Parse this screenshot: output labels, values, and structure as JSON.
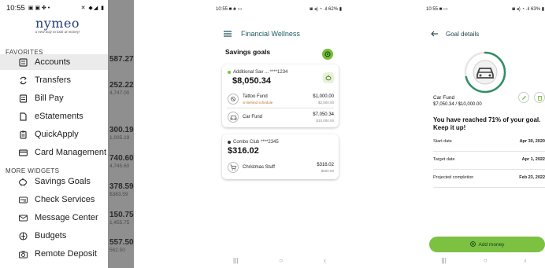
{
  "screen1": {
    "status": {
      "time": "10:55",
      "icons": "▣ ▣ ✤ •",
      "right": "✕ ◆◢ ▮"
    },
    "logo": {
      "word": "nymeo",
      "tagline": "a new way to look at money!"
    },
    "favorites_label": "FAVORITES",
    "favorites": [
      {
        "label": "Accounts",
        "icon": "accounts-icon",
        "active": true
      },
      {
        "label": "Transfers",
        "icon": "transfers-icon",
        "active": false
      },
      {
        "label": "Bill Pay",
        "icon": "bill-pay-icon",
        "active": false
      },
      {
        "label": "eStatements",
        "icon": "document-icon",
        "active": false
      },
      {
        "label": "QuickApply",
        "icon": "clipboard-icon",
        "active": false
      },
      {
        "label": "Card Management",
        "icon": "card-icon",
        "active": false
      }
    ],
    "more_label": "MORE WIDGETS",
    "more": [
      {
        "label": "Savings Goals",
        "icon": "piggy-bank-icon"
      },
      {
        "label": "Check Services",
        "icon": "check-icon"
      },
      {
        "label": "Message Center",
        "icon": "mail-icon"
      },
      {
        "label": "Budgets",
        "icon": "budget-icon"
      },
      {
        "label": "Remote Deposit",
        "icon": "camera-icon"
      }
    ],
    "background_amounts": [
      {
        "amount": "587.27",
        "sub": ""
      },
      {
        "amount": "252.22",
        "sub": "4,747.00"
      },
      {
        "amount": "300.19",
        "sub": "1,005.19"
      },
      {
        "amount": "740.60",
        "sub": "4,745.60"
      },
      {
        "amount": "378.59",
        "sub": "$383.59"
      },
      {
        "amount": "150.75",
        "sub": "1,455.75"
      },
      {
        "amount": "557.50",
        "sub": "562.50"
      }
    ]
  },
  "screen2": {
    "status": {
      "time": "10:55 ■ ♣ ▭",
      "right": "◙ ◂) ◔ .ıl 62% ▮"
    },
    "title": "Financial Wellness",
    "section_title": "Savings goals",
    "accounts": [
      {
        "name": "Additional Sav ... ****1234",
        "balance": "$8,050.34",
        "dot_color": "#7cc142",
        "goals": [
          {
            "name": "Tattoo Fund",
            "warning": "Behind schedule",
            "amount": "$1,000.00",
            "target": "$2,500.00",
            "icon": "tattoo-icon"
          },
          {
            "name": "Car Fund",
            "warning": "",
            "amount": "$7,050.34",
            "target": "$10,000.00",
            "icon": "car-icon"
          }
        ]
      },
      {
        "name": "Combo Club ****2345",
        "balance": "$316.02",
        "dot_color": "#333333",
        "goals": [
          {
            "name": "Christmas Stuff",
            "warning": "",
            "amount": "$316.02",
            "target": "$500.00",
            "icon": "cart-icon"
          }
        ]
      }
    ],
    "nav": [
      "|||",
      "○",
      "‹"
    ]
  },
  "screen3": {
    "status": {
      "time": "10:55 ■ ▭",
      "right": "◙ ◂) ◔ .ıl 63% ▮"
    },
    "title": "Goal details",
    "goal_name": "Car Fund",
    "goal_amount": "$7,050.34 / $10,000.00",
    "progress": 0.71,
    "message": "You have reached 71% of your goal. Keep it up!",
    "rows": [
      {
        "key": "Start date",
        "value": "Apr 30, 2020"
      },
      {
        "key": "Target date",
        "value": "Apr 1, 2022"
      },
      {
        "key": "Projected completion",
        "value": "Feb 23, 2022"
      }
    ],
    "add_button": "Add money",
    "nav": [
      "|||",
      "○",
      "‹"
    ],
    "colors": {
      "accent": "#7cc142",
      "ring": "#2f8f62"
    }
  }
}
